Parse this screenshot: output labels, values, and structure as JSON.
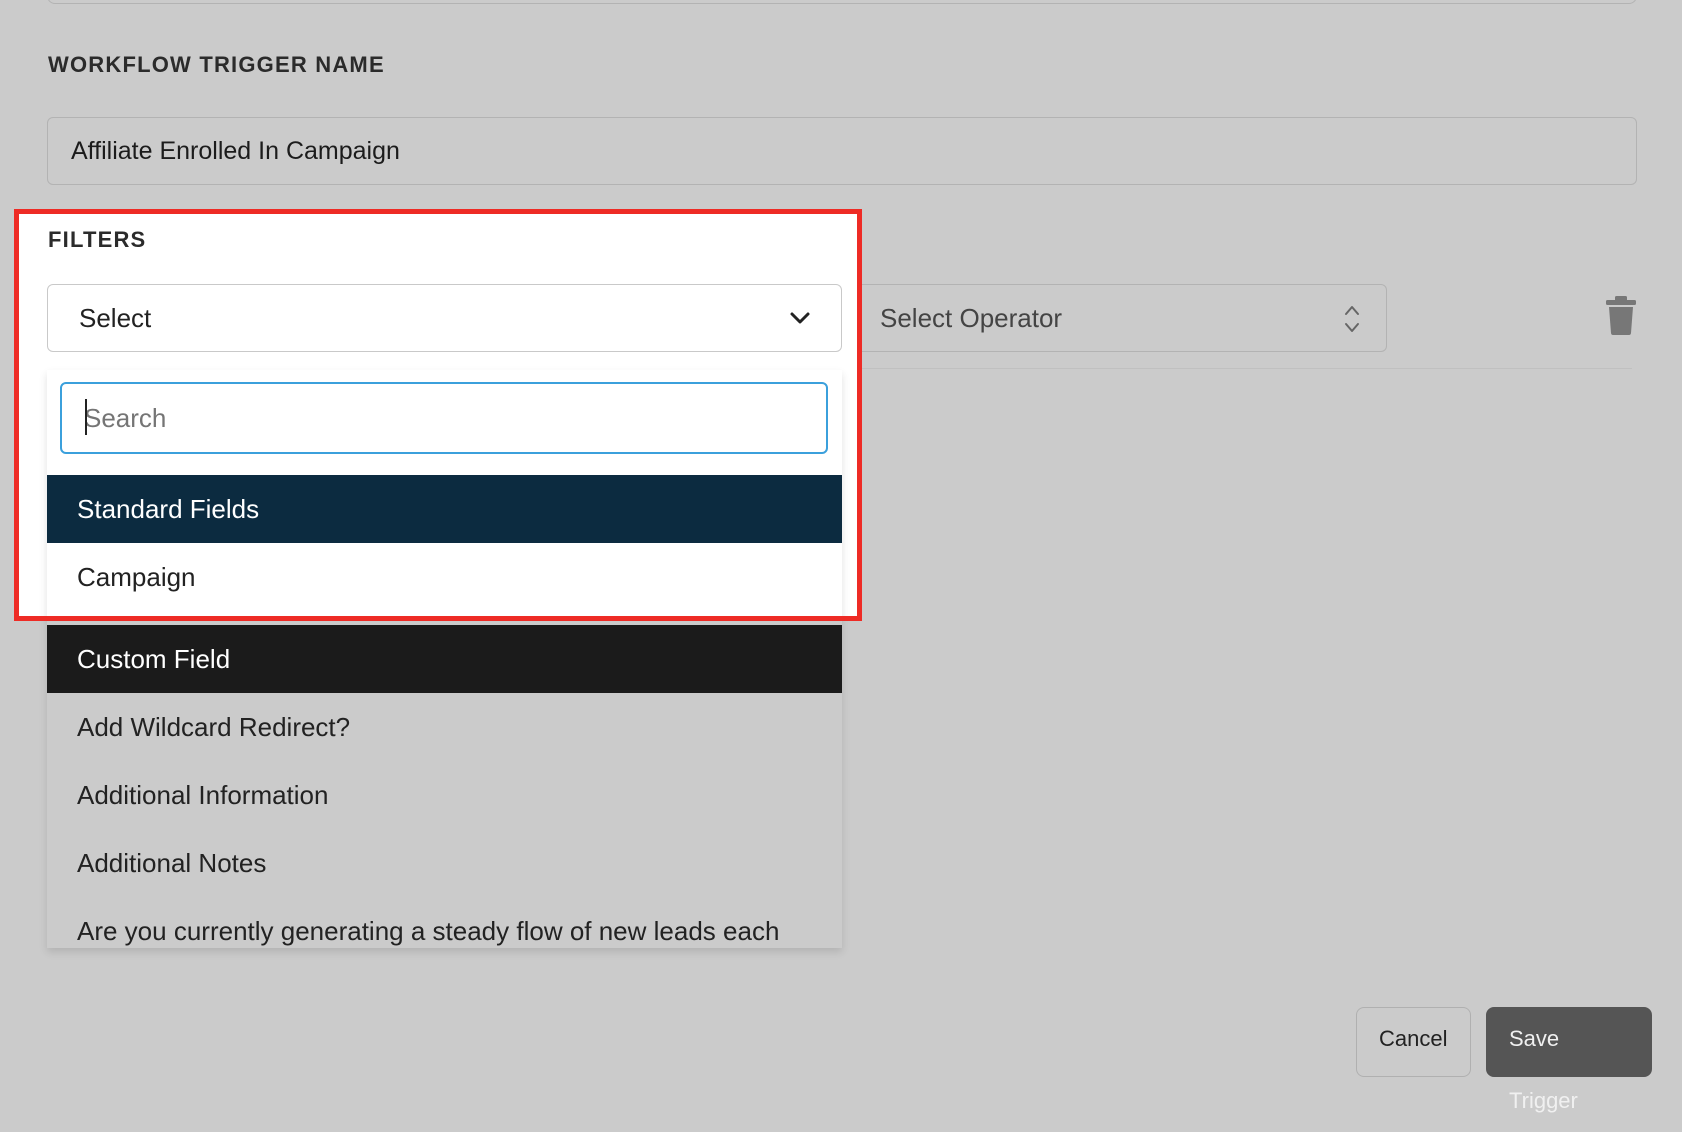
{
  "form": {
    "trigger_name_label": "WORKFLOW TRIGGER NAME",
    "trigger_name_value": "Affiliate Enrolled In Campaign",
    "filters_label": "FILTERS"
  },
  "filter_row": {
    "field_select_value": "Select",
    "operator_placeholder": "Select Operator"
  },
  "dropdown": {
    "search_placeholder": "Search",
    "groups": [
      {
        "header": "Standard Fields",
        "header_color": "#0c2b40",
        "options": [
          "Campaign"
        ]
      },
      {
        "header": "Custom Field",
        "header_color": "#1b1b1b",
        "options": [
          "Add Wildcard Redirect?",
          "Additional Information",
          "Additional Notes",
          "Are you currently generating a steady flow of new leads each"
        ]
      }
    ]
  },
  "actions": {
    "cancel_label": "Cancel",
    "save_label": "Save Trigger"
  },
  "colors": {
    "highlight_border": "#ee2b25",
    "search_focus": "#3ba0dc"
  }
}
